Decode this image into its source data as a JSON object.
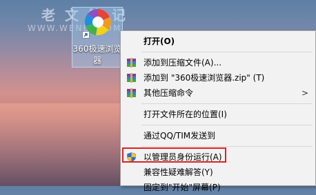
{
  "watermark": {
    "text": "老文笔记",
    "url": "WWW.WENBI.COM"
  },
  "desktop_icon": {
    "label": "360极速浏览器"
  },
  "context_menu": {
    "items": [
      {
        "label": "打开(O)"
      },
      {
        "label": "添加到压缩文件(A)...",
        "icon": "winrar-archive-icon"
      },
      {
        "label": "添加到 \"360极速浏览器.zip\" (T)",
        "icon": "winrar-archive-icon"
      },
      {
        "label": "其他压缩命令",
        "icon": "winrar-archive-icon",
        "submenu_arrow": ">"
      },
      {
        "label": "打开文件所在的位置(I)"
      },
      {
        "label": "通过QQ/TIM发送到"
      },
      {
        "label": "以管理员身份运行(A)",
        "icon": "uac-shield-icon"
      },
      {
        "label": "兼容性疑难解答(Y)"
      },
      {
        "label": "固定到\"开始\"屏幕(P)"
      }
    ]
  },
  "colors": {
    "highlight_border": "#e02020",
    "menu_background": "#f2f2f2"
  }
}
